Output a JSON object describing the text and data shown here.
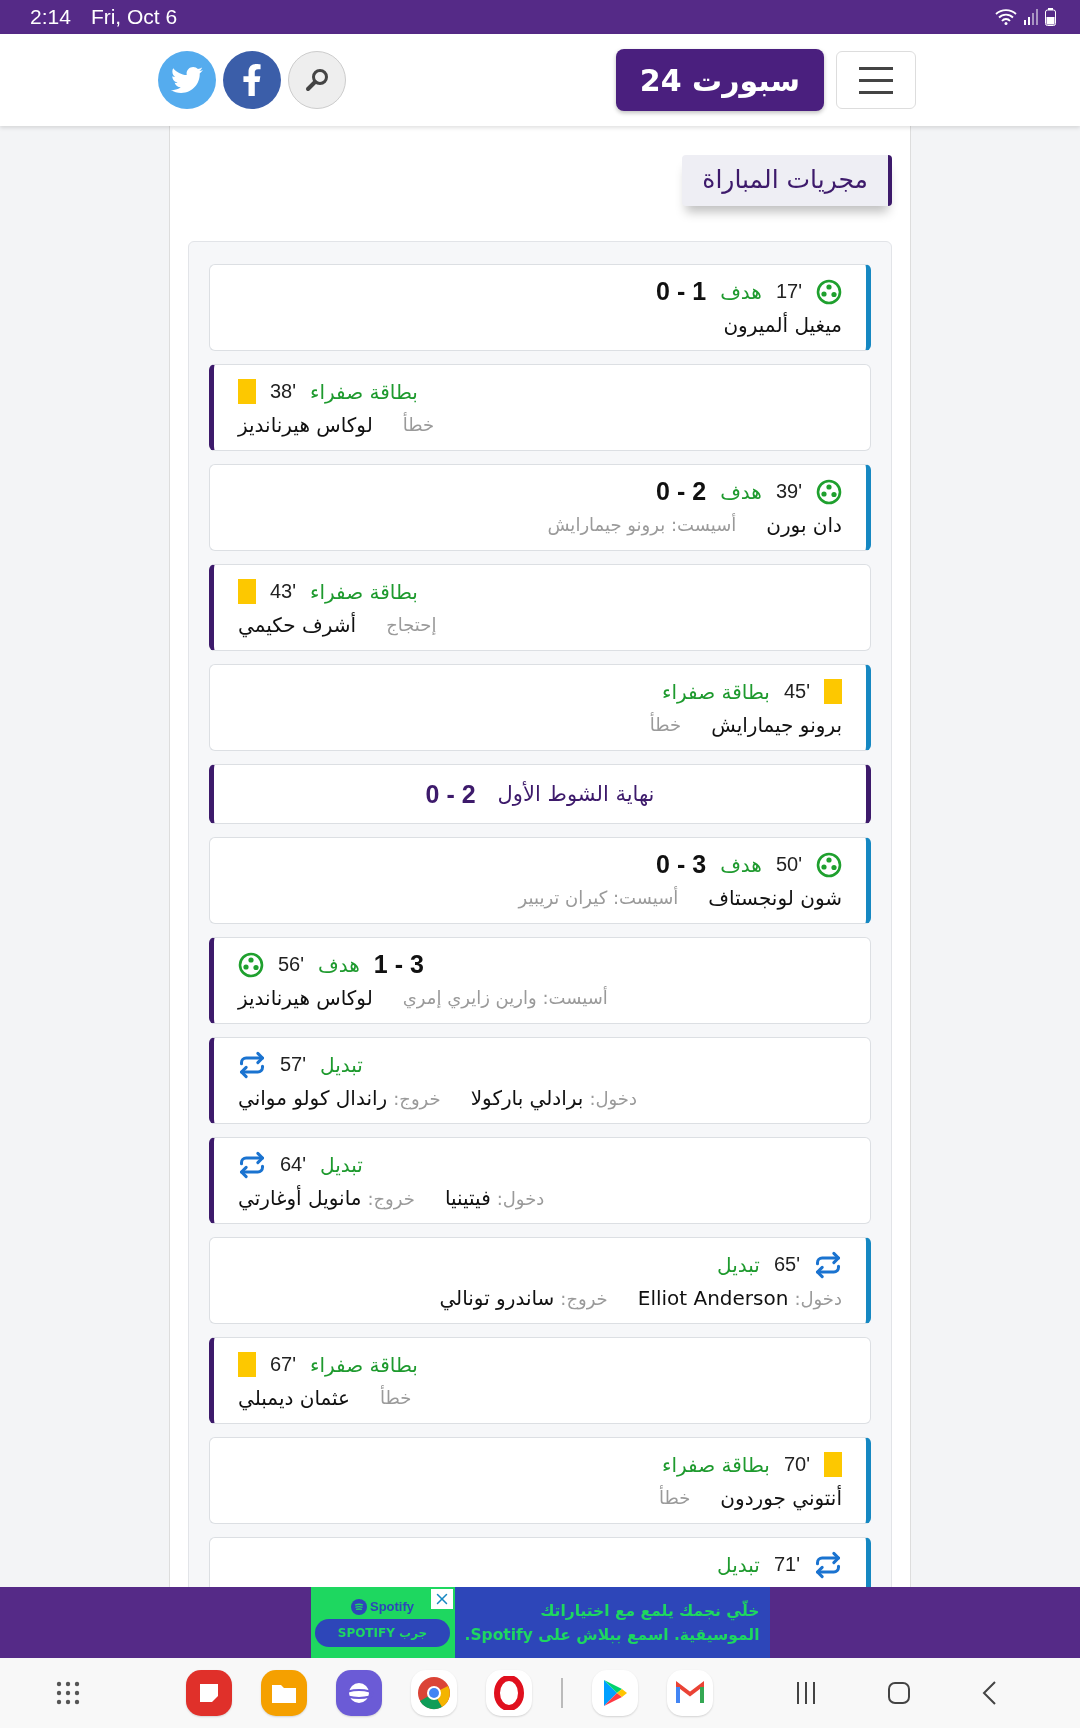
{
  "status_bar": {
    "time": "2:14",
    "date": "Fri, Oct 6"
  },
  "header": {
    "logo": "سبورت 24"
  },
  "section_title": "مجريات المباراة",
  "events": [
    {
      "kind": "goal",
      "home": true,
      "minute": "17'",
      "label": "هدف",
      "score": "0 - 1",
      "player": "ميغيل ألميرون"
    },
    {
      "kind": "card",
      "home": false,
      "minute": "38'",
      "label": "بطاقة صفراء",
      "player": "لوكاس هيرنانديز",
      "detail": "خطأ"
    },
    {
      "kind": "goal",
      "home": true,
      "minute": "39'",
      "label": "هدف",
      "score": "0 - 2",
      "player": "دان بورن",
      "detail": "أسيست: برونو جيمارايش"
    },
    {
      "kind": "card",
      "home": false,
      "minute": "43'",
      "label": "بطاقة صفراء",
      "player": "أشرف حكيمي",
      "detail": "إحتجاج"
    },
    {
      "kind": "card",
      "home": true,
      "minute": "45'",
      "label": "بطاقة صفراء",
      "player": "برونو جيمارايش",
      "detail": "خطأ"
    },
    {
      "kind": "halftime",
      "label": "نهاية الشوط الأول",
      "score": "0 - 2"
    },
    {
      "kind": "goal",
      "home": true,
      "minute": "50'",
      "label": "هدف",
      "score": "0 - 3",
      "player": "شون لونجستاف",
      "detail": "أسيست: كيران تريبير"
    },
    {
      "kind": "goal",
      "home": false,
      "minute": "56'",
      "label": "هدف",
      "score": "1 - 3",
      "player": "لوكاس هيرنانديز",
      "detail": "أسيست: وارين زايري إمري"
    },
    {
      "kind": "sub",
      "home": false,
      "minute": "57'",
      "label": "تبديل",
      "in_label": "دخول:",
      "in_player": "برادلي باركولا",
      "out_label": "خروج:",
      "out_player": "راندال كولو مواني"
    },
    {
      "kind": "sub",
      "home": false,
      "minute": "64'",
      "label": "تبديل",
      "in_label": "دخول:",
      "in_player": "فيتينيا",
      "out_label": "خروج:",
      "out_player": "مانويل أوغارتي"
    },
    {
      "kind": "sub",
      "home": true,
      "minute": "65'",
      "label": "تبديل",
      "in_label": "دخول:",
      "in_player": "Elliot Anderson",
      "out_label": "خروج:",
      "out_player": "ساندرو تونالي"
    },
    {
      "kind": "card",
      "home": false,
      "minute": "67'",
      "label": "بطاقة صفراء",
      "player": "عثمان ديمبلي",
      "detail": "خطأ"
    },
    {
      "kind": "card",
      "home": true,
      "minute": "70'",
      "label": "بطاقة صفراء",
      "player": "أنتوني جوردون",
      "detail": "خطأ"
    },
    {
      "kind": "sub",
      "home": true,
      "minute": "71'",
      "label": "تبديل"
    }
  ],
  "ad": {
    "headline_lines": [
      "خلّي نجمك يلمع مع اختياراتك",
      "الموسيقية. اسمع ببلاش على Spotify."
    ],
    "brand": "Spotify",
    "button": "جرب SPOTIFY"
  }
}
